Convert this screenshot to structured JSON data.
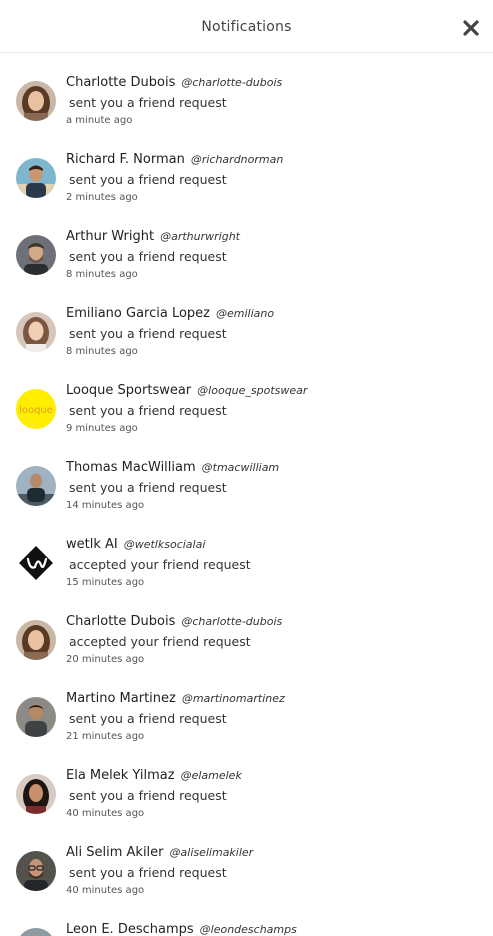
{
  "header": {
    "title": "Notifications"
  },
  "notifications": [
    {
      "name": "Charlotte Dubois",
      "handle": "@charlotte-dubois",
      "message": "sent you a friend request",
      "time": "a minute ago",
      "avatar": "woman-brown-hair"
    },
    {
      "name": "Richard F. Norman",
      "handle": "@richardnorman",
      "message": "sent you a friend request",
      "time": "2 minutes ago",
      "avatar": "man-beach"
    },
    {
      "name": "Arthur Wright",
      "handle": "@arthurwright",
      "message": "sent you a friend request",
      "time": "8 minutes ago",
      "avatar": "man-beard-gray"
    },
    {
      "name": "Emiliano Garcia Lopez",
      "handle": "@emiliano",
      "message": "sent you a friend request",
      "time": "8 minutes ago",
      "avatar": "woman-light"
    },
    {
      "name": "Looque Sportswear",
      "handle": "@looque_spotswear",
      "message": "sent you a friend request",
      "time": "9 minutes ago",
      "avatar": "looque-logo",
      "logo_text": "looque"
    },
    {
      "name": "Thomas MacWilliam",
      "handle": "@tmacwilliam",
      "message": "sent you a friend request",
      "time": "14 minutes ago",
      "avatar": "man-runner"
    },
    {
      "name": "wetlk AI",
      "handle": "@wetlksocialai",
      "message": "accepted your friend request",
      "time": "15 minutes ago",
      "avatar": "wetlk-logo"
    },
    {
      "name": "Charlotte Dubois",
      "handle": "@charlotte-dubois",
      "message": "accepted your friend request",
      "time": "20 minutes ago",
      "avatar": "woman-brown-hair"
    },
    {
      "name": "Martino Martinez",
      "handle": "@martinomartinez",
      "message": "sent you a friend request",
      "time": "21 minutes ago",
      "avatar": "man-gym"
    },
    {
      "name": "Ela Melek Yilmaz",
      "handle": "@elamelek",
      "message": "sent you a friend request",
      "time": "40 minutes ago",
      "avatar": "woman-dark-hair"
    },
    {
      "name": "Ali Selim Akiler",
      "handle": "@aliselimakiler",
      "message": "sent you a friend request",
      "time": "40 minutes ago",
      "avatar": "man-glasses"
    },
    {
      "name": "Leon E. Deschamps",
      "handle": "@leondeschamps",
      "message": "sent you a friend request",
      "time": "",
      "avatar": "man-partial"
    }
  ],
  "colors": {
    "background": "#ffffff",
    "divider": "#e6e6e6",
    "looque": "#ffee00"
  }
}
